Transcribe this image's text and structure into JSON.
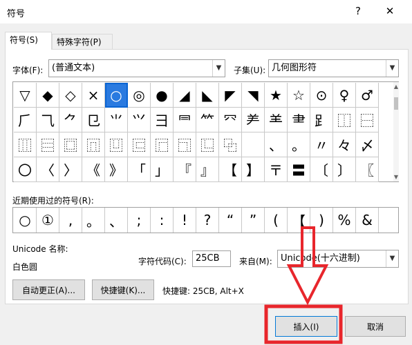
{
  "window": {
    "title": "符号",
    "help": "?",
    "close": "✕"
  },
  "tabs": [
    {
      "label": "符号(S)"
    },
    {
      "label": "特殊字符(P)"
    }
  ],
  "font": {
    "label": "字体(F):",
    "value": "(普通文本)"
  },
  "subset": {
    "label": "子集(U):",
    "value": "几何图形符"
  },
  "grid": {
    "rows": [
      [
        "▽",
        "◆",
        "◇",
        "×",
        "○",
        "◎",
        "●",
        "◢",
        "◣",
        "◤",
        "◥",
        "★",
        "☆",
        "⊙",
        "♀",
        "♂"
      ],
      [
        "⺁",
        "⺄",
        "⺈",
        "⺋",
        "⺌",
        "⺍",
        "⺕",
        "⺜",
        "⺮",
        "⺳",
        "⺶",
        "⺷",
        "⺻",
        "⻊",
        "⿰",
        "⿱"
      ],
      [
        "⿲",
        "⿳",
        "⿴",
        "⿵",
        "⿶",
        "⿷",
        "⿸",
        "⿹",
        "⿺",
        "⿻",
        "",
        "、",
        "。",
        "〃",
        "々",
        "〆"
      ],
      [
        "〇",
        "〈",
        "〉",
        "《",
        "》",
        "「",
        "」",
        "『",
        "』",
        "【",
        "】",
        "〒",
        "〓",
        "〔",
        "〕",
        "〖"
      ]
    ],
    "selected_row": 0,
    "selected_col": 4
  },
  "recent": {
    "label": "近期使用过的符号(R):",
    "symbols": [
      "○",
      "①",
      ",",
      "。",
      "、",
      ";",
      ":",
      "!",
      "?",
      "“",
      "”",
      "(",
      "【",
      ")",
      "%",
      "&"
    ]
  },
  "unicode_name": {
    "label": "Unicode 名称:",
    "value": "白色圆"
  },
  "char_code": {
    "label": "字符代码(C):",
    "value": "25CB"
  },
  "from": {
    "label": "来自(M):",
    "value": "Unicode(十六进制)"
  },
  "buttons": {
    "autocorrect": "自动更正(A)...",
    "shortcut_key": "快捷键(K)...",
    "shortcut_info": "快捷键: 25CB, Alt+X",
    "insert": "插入(I)",
    "cancel": "取消"
  },
  "colors": {
    "annotation": "#e8262c",
    "selection": "#0a64d2"
  }
}
